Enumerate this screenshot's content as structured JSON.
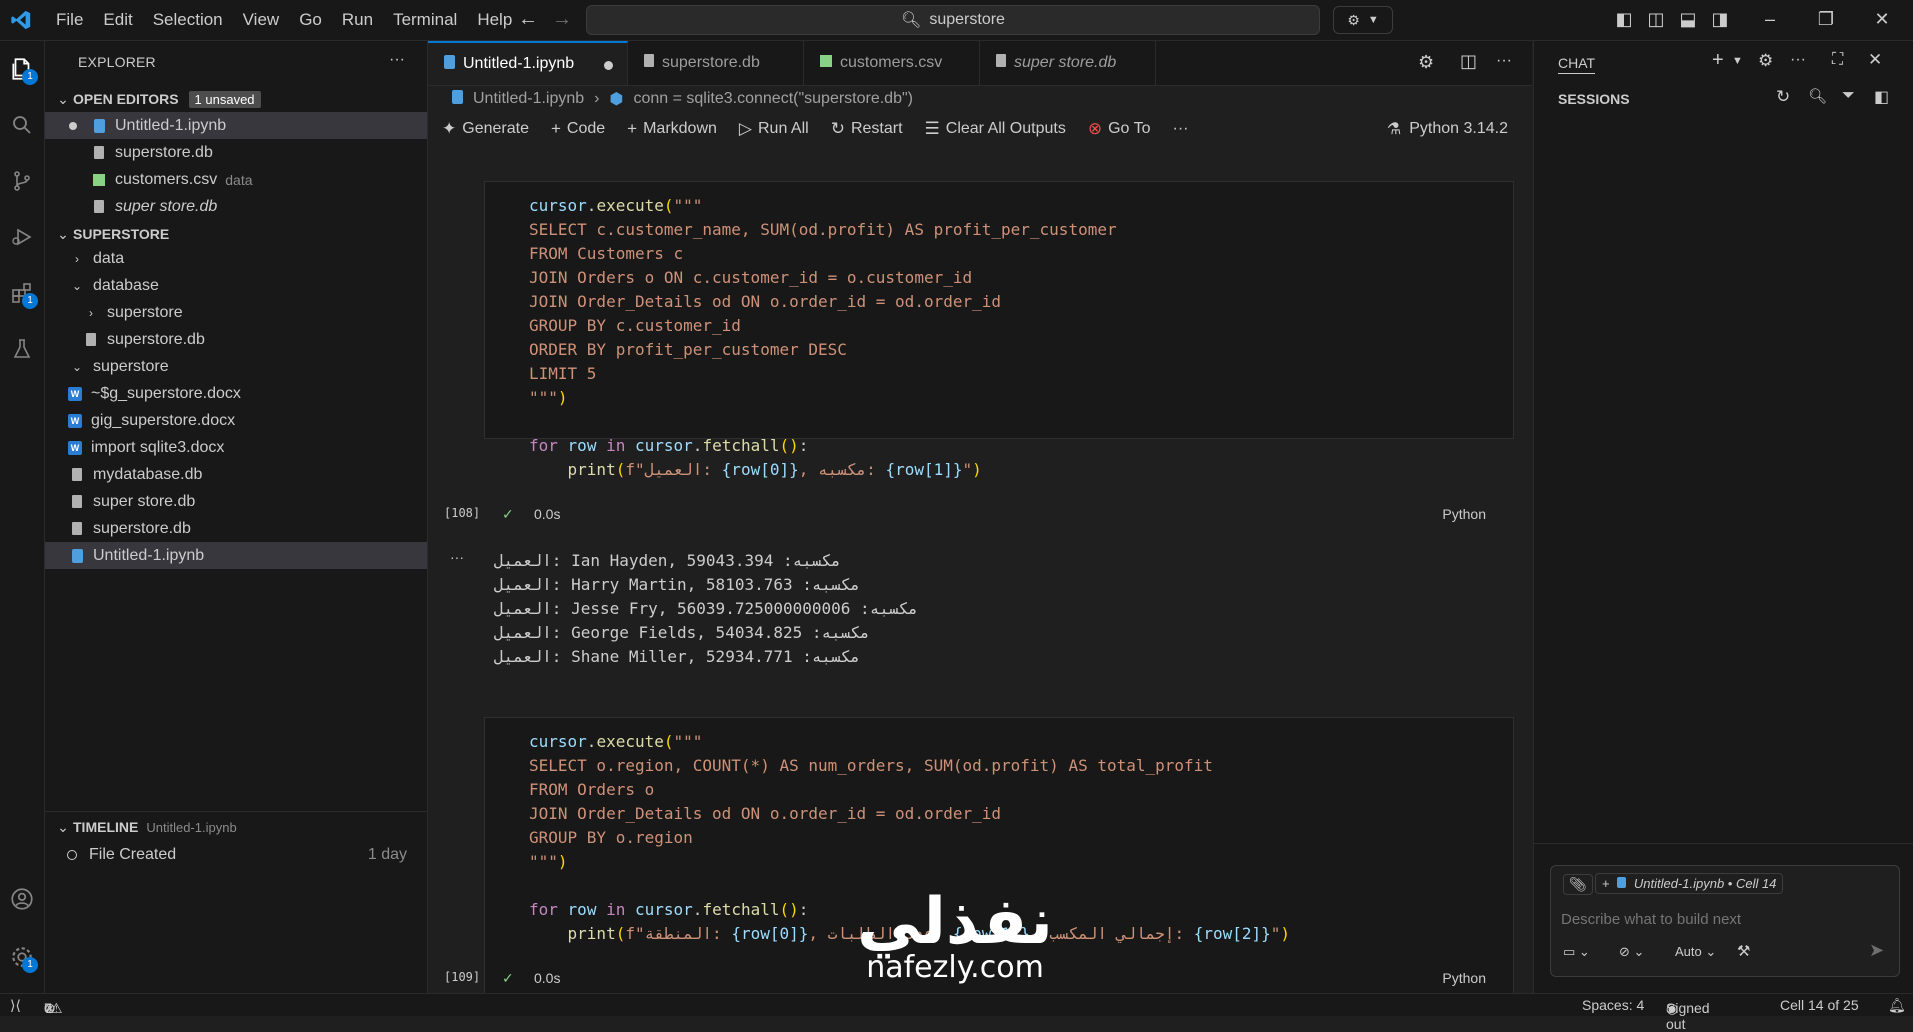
{
  "titlebar": {
    "menu": [
      "File",
      "Edit",
      "Selection",
      "View",
      "Go",
      "Run",
      "Terminal",
      "Help"
    ],
    "search": "superstore"
  },
  "activity": {
    "explorer_badge": "1",
    "extensions_badge": "1",
    "manage_badge": "1"
  },
  "explorer": {
    "title": "EXPLORER",
    "open_editors": {
      "label": "OPEN EDITORS",
      "unsaved": "1 unsaved"
    },
    "open_files": [
      {
        "name": "Untitled-1.ipynb"
      },
      {
        "name": "superstore.db"
      },
      {
        "name": "customers.csv",
        "desc": "data"
      },
      {
        "name": "super store.db"
      }
    ],
    "folder": "SUPERSTORE",
    "tree": [
      "data",
      "database",
      "superstore",
      "superstore.db",
      "superstore",
      "~$g_superstore.docx",
      "gig_superstore.docx",
      "import sqlite3.docx",
      "mydatabase.db",
      "super store.db",
      "superstore.db",
      "Untitled-1.ipynb"
    ],
    "timeline": {
      "label": "TIMELINE",
      "file": "Untitled-1.ipynb",
      "entry": "File Created",
      "when": "1 day"
    }
  },
  "tabs": [
    "Untitled-1.ipynb",
    "superstore.db",
    "customers.csv",
    "super store.db"
  ],
  "breadcrumb": {
    "file": "Untitled-1.ipynb",
    "sep": "›",
    "symbol": "conn = sqlite3.connect(\"superstore.db\")"
  },
  "toolbar": {
    "generate": "Generate",
    "code": "Code",
    "markdown": "Markdown",
    "run_all": "Run All",
    "restart": "Restart",
    "clear": "Clear All Outputs",
    "goto": "Go To",
    "more": "···",
    "kernel": "Python 3.14.2"
  },
  "cells": [
    {
      "exec": "[108]",
      "time": "0.0s",
      "lang": "Python",
      "output": [
        "العميل: Ian Hayden, 59043.394 :مكسبه",
        "العميل: Harry Martin, 58103.763 :مكسبه",
        "العميل: Jesse Fry, 56039.725000000006 :مكسبه",
        "العميل: George Fields, 54034.825 :مكسبه",
        "العميل: Shane Miller, 52934.771 :مكسبه"
      ]
    },
    {
      "exec": "[109]",
      "time": "0.0s",
      "lang": "Python"
    }
  ],
  "chat": {
    "title": "CHAT",
    "sessions": "SESSIONS",
    "context": "Untitled-1.ipynb • Cell 14",
    "placeholder": "Describe what to build next",
    "mode": "Auto"
  },
  "status": {
    "errors": "7",
    "warnings": "0",
    "spaces": "Spaces: 4",
    "account": "Signed out",
    "cell": "Cell 14 of 25"
  },
  "watermark": {
    "arabic": "نفذلي",
    "site": "nafezly.com"
  },
  "colors": {
    "accent": "#0078d4",
    "sql": "#ce9178",
    "keyword": "#c586c0",
    "func": "#dcdcaa",
    "var": "#9cdcfe"
  }
}
